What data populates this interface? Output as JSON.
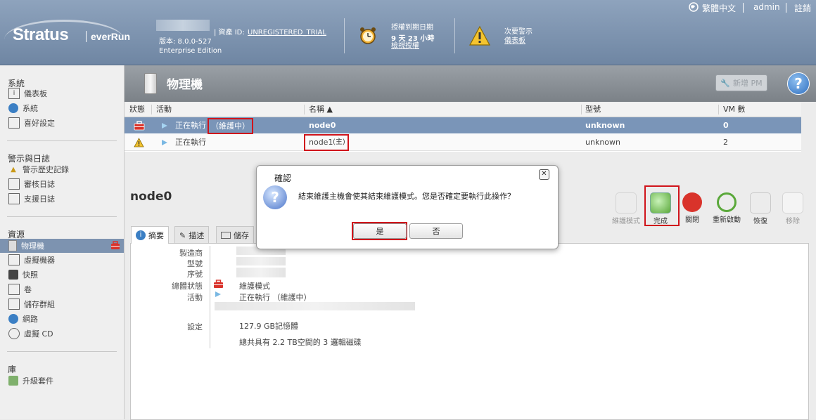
{
  "header": {
    "logo_main": "Stratus",
    "logo_sub": "everRun",
    "version": "版本: 8.0.0-527",
    "edition": "Enterprise Edition",
    "asset_label": "| 資產 ID:",
    "asset_id": "UNREGISTERED_TRIAL",
    "license_title": "授權到期日期",
    "license_remaining": "9 天 23 小時",
    "license_link": "檢視授權",
    "alert_title": "次要警示",
    "alert_link": "儀表板",
    "lang": "繁體中文",
    "user": "admin",
    "logout": "註銷"
  },
  "sidebar": {
    "sections": [
      {
        "title": "系統",
        "items": [
          "儀表板",
          "系統",
          "喜好設定"
        ]
      },
      {
        "title": "警示與日誌",
        "items": [
          "警示歷史記錄",
          "審核日誌",
          "支援日誌"
        ]
      },
      {
        "title": "資源",
        "items": [
          "物理機",
          "虛擬機器",
          "快照",
          "卷",
          "儲存群組",
          "網路",
          "虛擬 CD"
        ]
      },
      {
        "title": "庫",
        "items": [
          "升級套件"
        ]
      }
    ],
    "active_item": "物理機"
  },
  "page": {
    "title": "物理機",
    "add_pm": "新增 PM"
  },
  "table": {
    "columns": [
      "狀態",
      "活動",
      "名稱 ▲",
      "型號",
      "VM 數"
    ],
    "rows": [
      {
        "activity": "正在執行",
        "activity_note": "（維護中）",
        "name": "node0",
        "model": "unknown",
        "vms": "0"
      },
      {
        "activity": "正在執行",
        "name": "node1",
        "name_note": "(主)",
        "model": "unknown",
        "vms": "2"
      }
    ]
  },
  "detail": {
    "title": "node0",
    "toolbar": [
      "維護模式",
      "完成",
      "關閉",
      "重新啟動",
      "恢復",
      "移除"
    ],
    "tabs": [
      "摘要",
      "描述",
      "儲存"
    ],
    "labels": {
      "manufacturer": "製造商",
      "model": "型號",
      "serial": "序號",
      "overall_state": "總體狀態",
      "activity": "活動",
      "config": "設定"
    },
    "overall_state_value": "維護模式",
    "activity_value": "正在執行 （維護中）",
    "memory": "127.9 GB記憶體",
    "disks": "總共具有 2.2 TB空間的 3 邏輯磁碟"
  },
  "dialog": {
    "title": "確認",
    "message": "結束維護主機會使其結束維護模式。您是否確定要執行此操作？",
    "yes": "是",
    "no": "否",
    "close": "✕"
  },
  "colors": {
    "header": "#7f95b1",
    "selected_row": "#7a95b8",
    "highlight": "#d0141b"
  }
}
